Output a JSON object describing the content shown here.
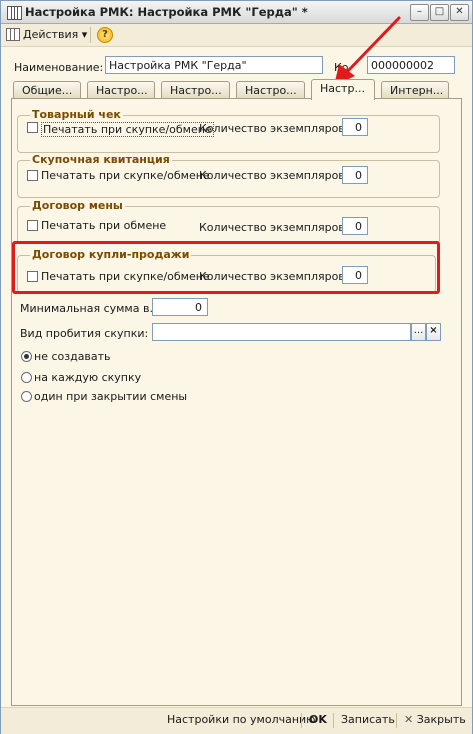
{
  "window": {
    "title": "Настройка РМК: Настройка РМК \"Герда\" *"
  },
  "toolbar": {
    "actions_label": "Действия",
    "actions_arrow": "▾",
    "help_label": "?"
  },
  "form": {
    "name_label": "Наименование:",
    "name_value": "Настройка РМК \"Герда\"",
    "code_label": "Ко",
    "code_value": "000000002"
  },
  "tabs": [
    {
      "label": "Общие..."
    },
    {
      "label": "Настро..."
    },
    {
      "label": "Настро..."
    },
    {
      "label": "Настро..."
    },
    {
      "label": "Настр..."
    },
    {
      "label": "Интерн..."
    }
  ],
  "groups": {
    "receipt": {
      "title": "Товарный чек",
      "checkbox_label": "Печатать при скупке/обмене",
      "qty_label": "Количество экземпляров",
      "qty_value": "0"
    },
    "purchase_receipt": {
      "title": "Скупочная квитанция",
      "checkbox_label": "Печатать при скупке/обмене",
      "qty_label": "Количество экземпляров",
      "qty_value": "0"
    },
    "exchange_contract": {
      "title": "Договор мены",
      "checkbox_label": "Печатать при обмене",
      "qty_label": "Количество экземпляров",
      "qty_value": "0"
    },
    "sale_contract": {
      "title": "Договор купли-продажи",
      "checkbox_label": "Печатать при скупке/обмене",
      "qty_label": "Количество экземпляров",
      "qty_value": "0"
    }
  },
  "min_sum": {
    "label": "Минимальная сумма в...",
    "value": "0"
  },
  "punch": {
    "label": "Вид пробития скупки:",
    "value": "",
    "pick_label": "...",
    "clear_label": "×"
  },
  "radio_options": [
    {
      "label": "не создавать",
      "selected": true
    },
    {
      "label": "на каждую скупку",
      "selected": false
    },
    {
      "label": "один при закрытии смены",
      "selected": false
    }
  ],
  "footer": {
    "defaults_label": "Настройки по умолчанию",
    "ok_label": "OK",
    "save_label": "Записать",
    "close_label": "Закрыть",
    "close_icon": "✕"
  },
  "colors": {
    "highlight": "#e01b1b",
    "group_title": "#7a4c00",
    "background": "#fbf6e6"
  }
}
